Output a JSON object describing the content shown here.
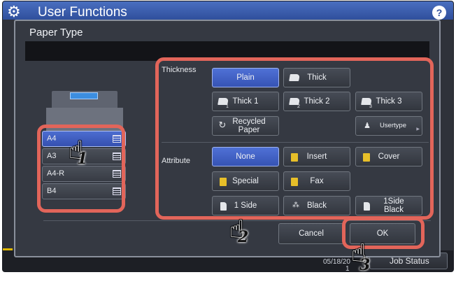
{
  "app": {
    "title": "User Functions",
    "help": "?"
  },
  "background": {
    "date_text": "05/18/20",
    "page_text": "1",
    "job_status": "Job Status"
  },
  "dialog": {
    "title": "Paper Type",
    "trays": [
      {
        "label": "A4",
        "selected": true
      },
      {
        "label": "A3",
        "selected": false
      },
      {
        "label": "A4-R",
        "selected": false
      },
      {
        "label": "B4",
        "selected": false
      }
    ],
    "thickness": {
      "label": "Thickness",
      "plain": "Plain",
      "thick": "Thick",
      "thick1": "Thick 1",
      "thick2": "Thick 2",
      "thick3": "Thick 3",
      "recycled": "Recycled Paper",
      "usertype": "Usertype",
      "selected": "Plain"
    },
    "attribute": {
      "label": "Attribute",
      "none": "None",
      "insert": "Insert",
      "cover": "Cover",
      "special": "Special",
      "fax": "Fax",
      "one_side": "1 Side",
      "black": "Black",
      "one_side_black": "1Side Black",
      "selected": "None"
    },
    "buttons": {
      "cancel": "Cancel",
      "ok": "OK"
    }
  },
  "callouts": {
    "step1": "1",
    "step2": "2",
    "step3": "3",
    "color": "#e2655a"
  },
  "colors": {
    "selected": "#3f60c6",
    "title_bar": "#3a5cae"
  }
}
